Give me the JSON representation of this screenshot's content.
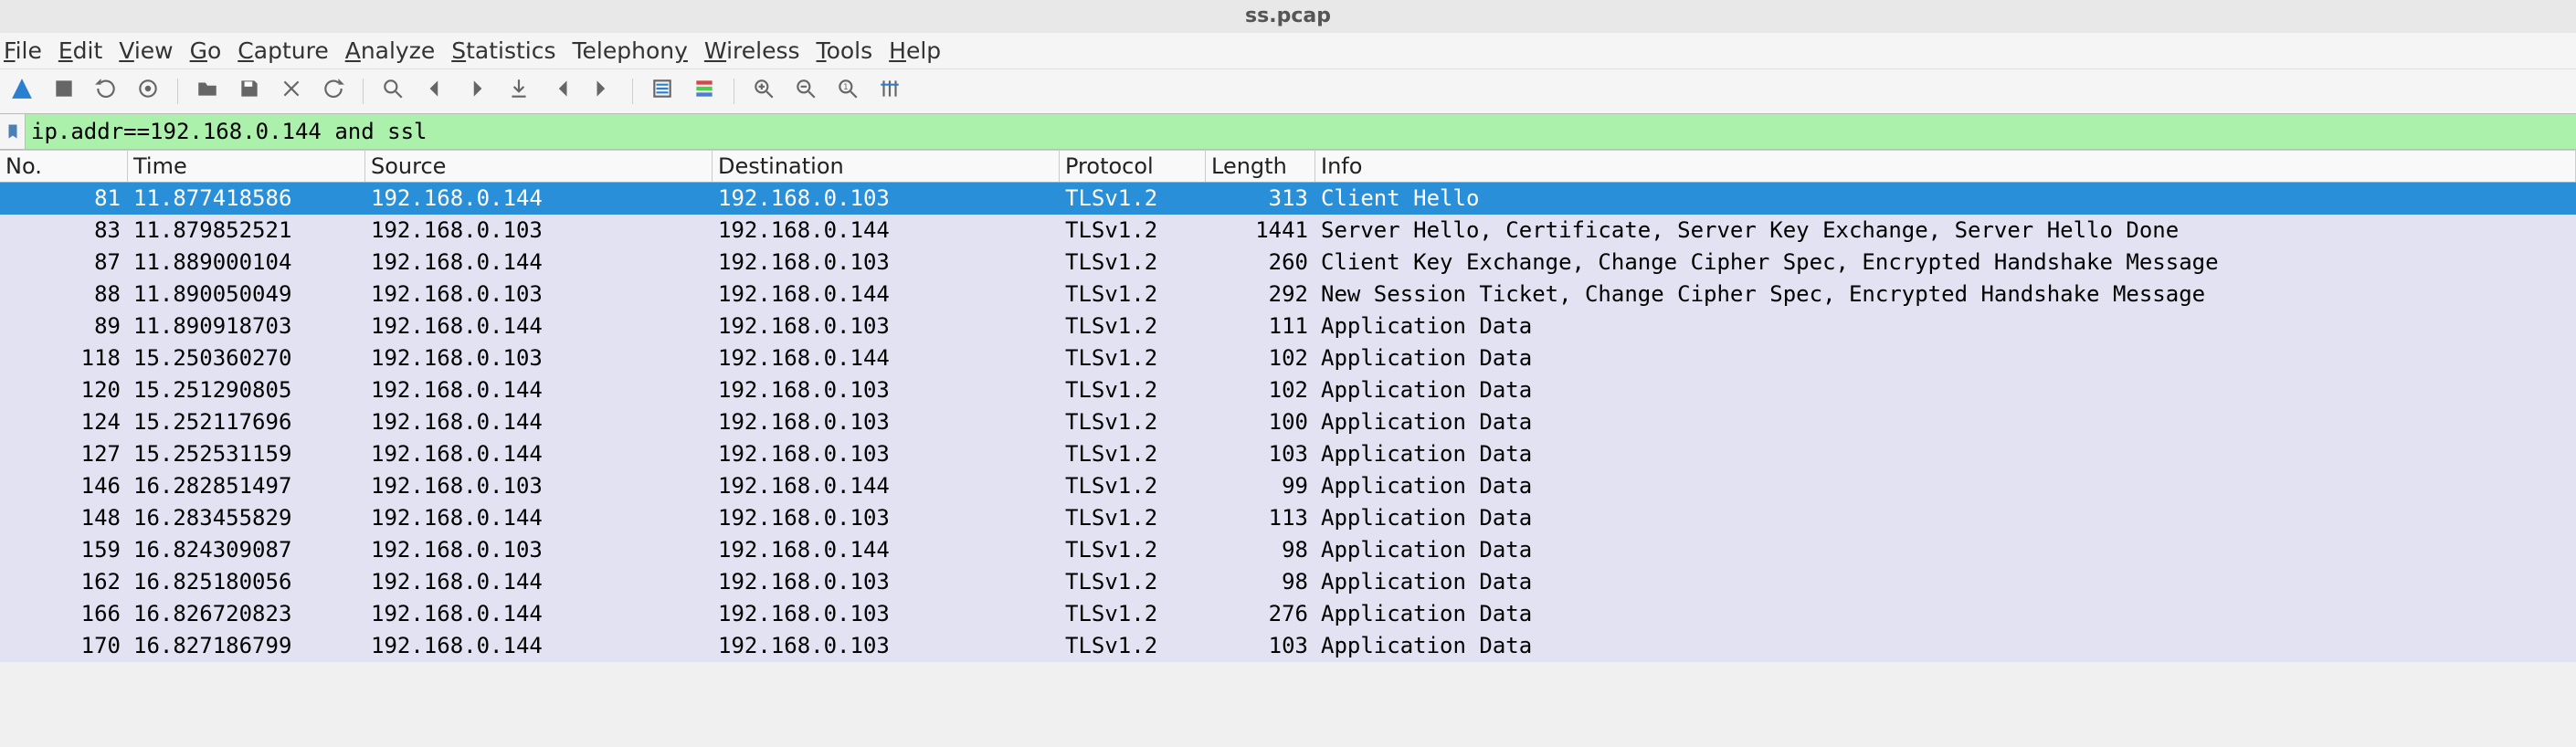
{
  "window": {
    "title": "ss.pcap"
  },
  "menu": {
    "file": "File",
    "edit": "Edit",
    "view": "View",
    "go": "Go",
    "capture": "Capture",
    "analyze": "Analyze",
    "statistics": "Statistics",
    "telephony": "Telephony",
    "wireless": "Wireless",
    "tools": "Tools",
    "help": "Help"
  },
  "toolbar": {
    "icons": [
      "start-capture",
      "stop-capture",
      "restart-capture",
      "capture-options",
      "sep",
      "open-file",
      "save-file",
      "close-file",
      "reload-file",
      "sep",
      "find-packet",
      "go-back",
      "go-forward",
      "go-to-packet",
      "go-first",
      "go-last",
      "sep",
      "auto-scroll",
      "colorize",
      "sep",
      "zoom-in",
      "zoom-out",
      "zoom-reset",
      "resize-columns"
    ]
  },
  "filter": {
    "value": "ip.addr==192.168.0.144 and ssl"
  },
  "columns": {
    "no": "No.",
    "time": "Time",
    "source": "Source",
    "destination": "Destination",
    "protocol": "Protocol",
    "length": "Length",
    "info": "Info"
  },
  "packets": [
    {
      "no": 81,
      "time": "11.877418586",
      "src": "192.168.0.144",
      "dst": "192.168.0.103",
      "proto": "TLSv1.2",
      "len": 313,
      "info": "Client Hello",
      "selected": true
    },
    {
      "no": 83,
      "time": "11.879852521",
      "src": "192.168.0.103",
      "dst": "192.168.0.144",
      "proto": "TLSv1.2",
      "len": 1441,
      "info": "Server Hello, Certificate, Server Key Exchange, Server Hello Done"
    },
    {
      "no": 87,
      "time": "11.889000104",
      "src": "192.168.0.144",
      "dst": "192.168.0.103",
      "proto": "TLSv1.2",
      "len": 260,
      "info": "Client Key Exchange, Change Cipher Spec, Encrypted Handshake Message"
    },
    {
      "no": 88,
      "time": "11.890050049",
      "src": "192.168.0.103",
      "dst": "192.168.0.144",
      "proto": "TLSv1.2",
      "len": 292,
      "info": "New Session Ticket, Change Cipher Spec, Encrypted Handshake Message"
    },
    {
      "no": 89,
      "time": "11.890918703",
      "src": "192.168.0.144",
      "dst": "192.168.0.103",
      "proto": "TLSv1.2",
      "len": 111,
      "info": "Application Data"
    },
    {
      "no": 118,
      "time": "15.250360270",
      "src": "192.168.0.103",
      "dst": "192.168.0.144",
      "proto": "TLSv1.2",
      "len": 102,
      "info": "Application Data"
    },
    {
      "no": 120,
      "time": "15.251290805",
      "src": "192.168.0.144",
      "dst": "192.168.0.103",
      "proto": "TLSv1.2",
      "len": 102,
      "info": "Application Data"
    },
    {
      "no": 124,
      "time": "15.252117696",
      "src": "192.168.0.144",
      "dst": "192.168.0.103",
      "proto": "TLSv1.2",
      "len": 100,
      "info": "Application Data"
    },
    {
      "no": 127,
      "time": "15.252531159",
      "src": "192.168.0.144",
      "dst": "192.168.0.103",
      "proto": "TLSv1.2",
      "len": 103,
      "info": "Application Data"
    },
    {
      "no": 146,
      "time": "16.282851497",
      "src": "192.168.0.103",
      "dst": "192.168.0.144",
      "proto": "TLSv1.2",
      "len": 99,
      "info": "Application Data"
    },
    {
      "no": 148,
      "time": "16.283455829",
      "src": "192.168.0.144",
      "dst": "192.168.0.103",
      "proto": "TLSv1.2",
      "len": 113,
      "info": "Application Data"
    },
    {
      "no": 159,
      "time": "16.824309087",
      "src": "192.168.0.103",
      "dst": "192.168.0.144",
      "proto": "TLSv1.2",
      "len": 98,
      "info": "Application Data"
    },
    {
      "no": 162,
      "time": "16.825180056",
      "src": "192.168.0.144",
      "dst": "192.168.0.103",
      "proto": "TLSv1.2",
      "len": 98,
      "info": "Application Data"
    },
    {
      "no": 166,
      "time": "16.826720823",
      "src": "192.168.0.144",
      "dst": "192.168.0.103",
      "proto": "TLSv1.2",
      "len": 276,
      "info": "Application Data"
    },
    {
      "no": 170,
      "time": "16.827186799",
      "src": "192.168.0.144",
      "dst": "192.168.0.103",
      "proto": "TLSv1.2",
      "len": 103,
      "info": "Application Data"
    }
  ]
}
